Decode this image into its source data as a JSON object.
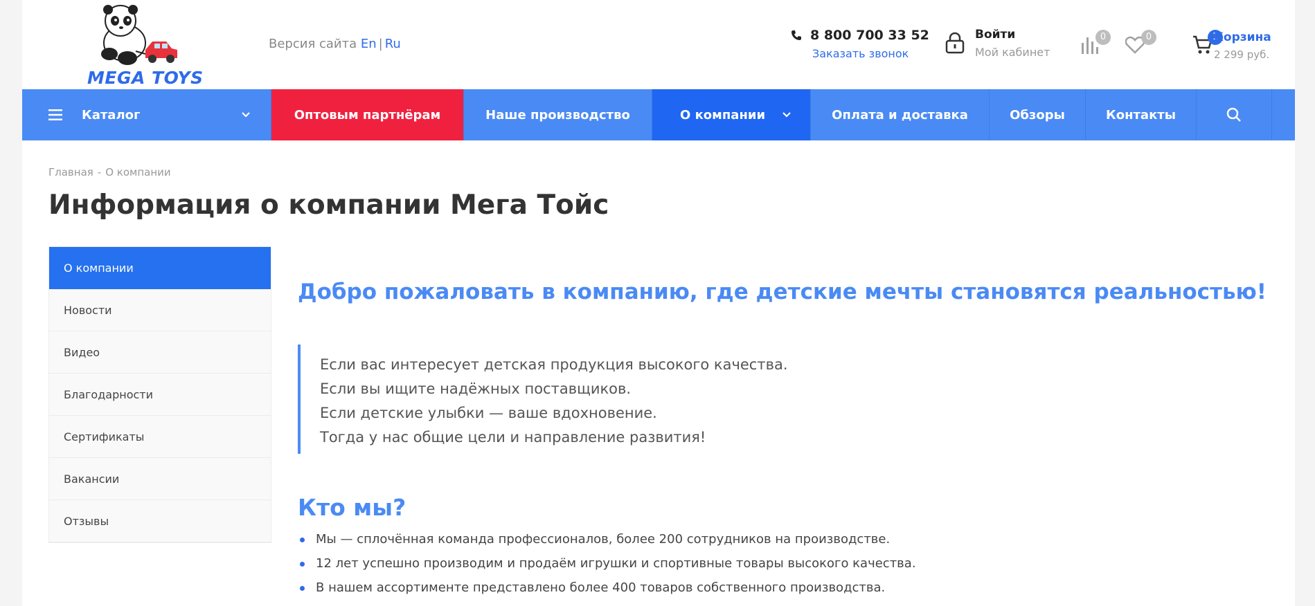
{
  "header": {
    "logo_text": "MEGA TOYS",
    "version_label": "Версия сайта",
    "lang_en": "En",
    "lang_sep": "|",
    "lang_ru": "Ru",
    "phone": "8 800 700 33 52",
    "callback_link": "Заказать звонок",
    "login_title": "Войти",
    "login_sub": "Мой кабинет",
    "compare_count": "0",
    "favorites_count": "0",
    "cart_count": "1",
    "cart_title": "Корзина",
    "cart_sum": "2 299 руб.",
    "icons": {
      "phone": "phone-icon",
      "login": "lock-icon",
      "compare": "bar-chart-icon",
      "favorites": "heart-icon",
      "cart": "cart-icon"
    }
  },
  "nav": {
    "catalog": "Каталог",
    "wholesale": "Оптовым партнёрам",
    "production": "Наше производство",
    "about": "О компании",
    "payment": "Оплата и доставка",
    "reviews": "Обзоры",
    "contacts": "Контакты"
  },
  "breadcrumb": {
    "home": "Главная",
    "sep": "-",
    "current": "О компании"
  },
  "page_title": "Информация о компании Мега Тойс",
  "sidebar": {
    "items": [
      {
        "label": "О компании",
        "active": true
      },
      {
        "label": "Новости"
      },
      {
        "label": "Видео"
      },
      {
        "label": "Благодарности"
      },
      {
        "label": "Сертификаты"
      },
      {
        "label": "Вакансии"
      },
      {
        "label": "Отзывы"
      }
    ]
  },
  "content": {
    "welcome": "Добро пожаловать в компанию, где детские мечты становятся реальностью!",
    "quote": [
      "Если вас интересует детская продукция высокого качества.",
      "Если вы ищите надёжных поставщиков.",
      "Если детские улыбки — ваше вдохновение.",
      "Тогда у нас общие цели и направление развития!"
    ],
    "who_title": "Кто мы?",
    "who_list": [
      "Мы — сплочённая команда профессионалов, более 200 сотрудников на производстве.",
      "12 лет успешно производим и продаём игрушки и спортивные товары высокого качества.",
      "В нашем ассортименте представлено более 400 товаров собственного производства."
    ]
  },
  "colors": {
    "brand_blue": "#4a8af4",
    "accent_red": "#f0213f",
    "active_blue": "#1f66f2"
  }
}
